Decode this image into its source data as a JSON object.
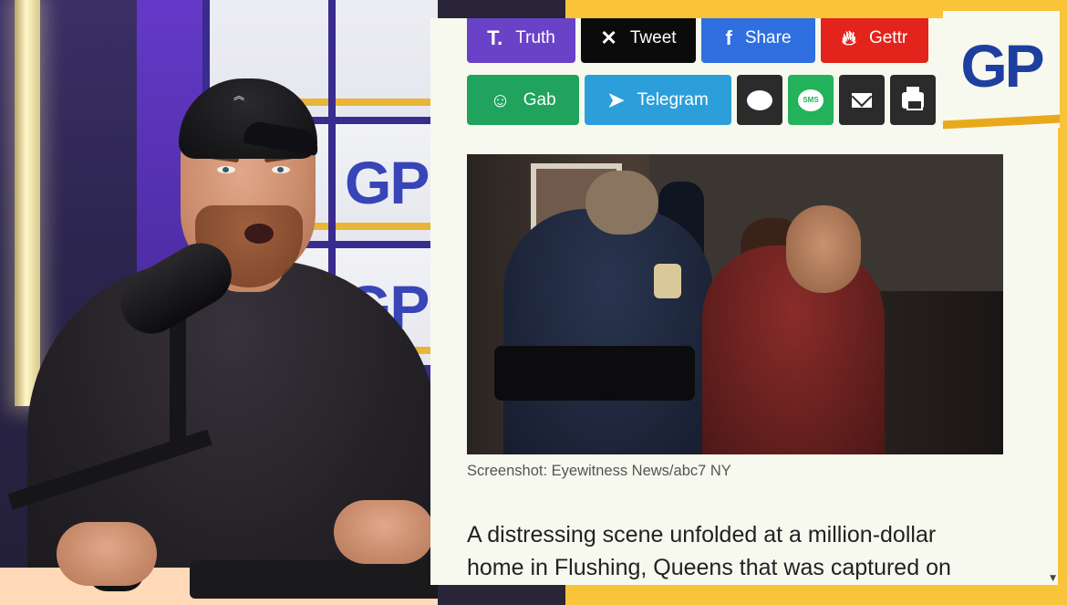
{
  "logo": {
    "text": "GP"
  },
  "studio_wall": {
    "tile_text": "GP"
  },
  "share_buttons": {
    "row1": [
      {
        "label": "Truth",
        "icon": "truth-social-icon",
        "color": "#6a42c8"
      },
      {
        "label": "Tweet",
        "icon": "x-icon",
        "color": "#0b0b0b"
      },
      {
        "label": "Share",
        "icon": "facebook-icon",
        "color": "#2f6fe0"
      },
      {
        "label": "Gettr",
        "icon": "gettr-icon",
        "color": "#e3241c"
      }
    ],
    "row2": [
      {
        "label": "Gab",
        "icon": "gab-frog-icon",
        "color": "#1fa35d"
      },
      {
        "label": "Telegram",
        "icon": "telegram-icon",
        "color": "#2c9fdb"
      },
      {
        "label": "",
        "icon": "comment-icon",
        "color": "#2b2b2b"
      },
      {
        "label": "SMS",
        "icon": "sms-icon",
        "color": "#24b25a"
      },
      {
        "label": "",
        "icon": "email-icon",
        "color": "#2b2b2b"
      },
      {
        "label": "",
        "icon": "print-icon",
        "color": "#2b2b2b"
      }
    ]
  },
  "article": {
    "image_caption": "Screenshot: Eyewitness News/abc7 NY",
    "body_line1": "A distressing scene unfolded at a million-dollar",
    "body_line2": "home in Flushing, Queens that was captured on"
  },
  "colors": {
    "accent_yellow": "#f9c33a",
    "brand_blue": "#1e3fa0",
    "article_bg": "#f7f9ee"
  }
}
